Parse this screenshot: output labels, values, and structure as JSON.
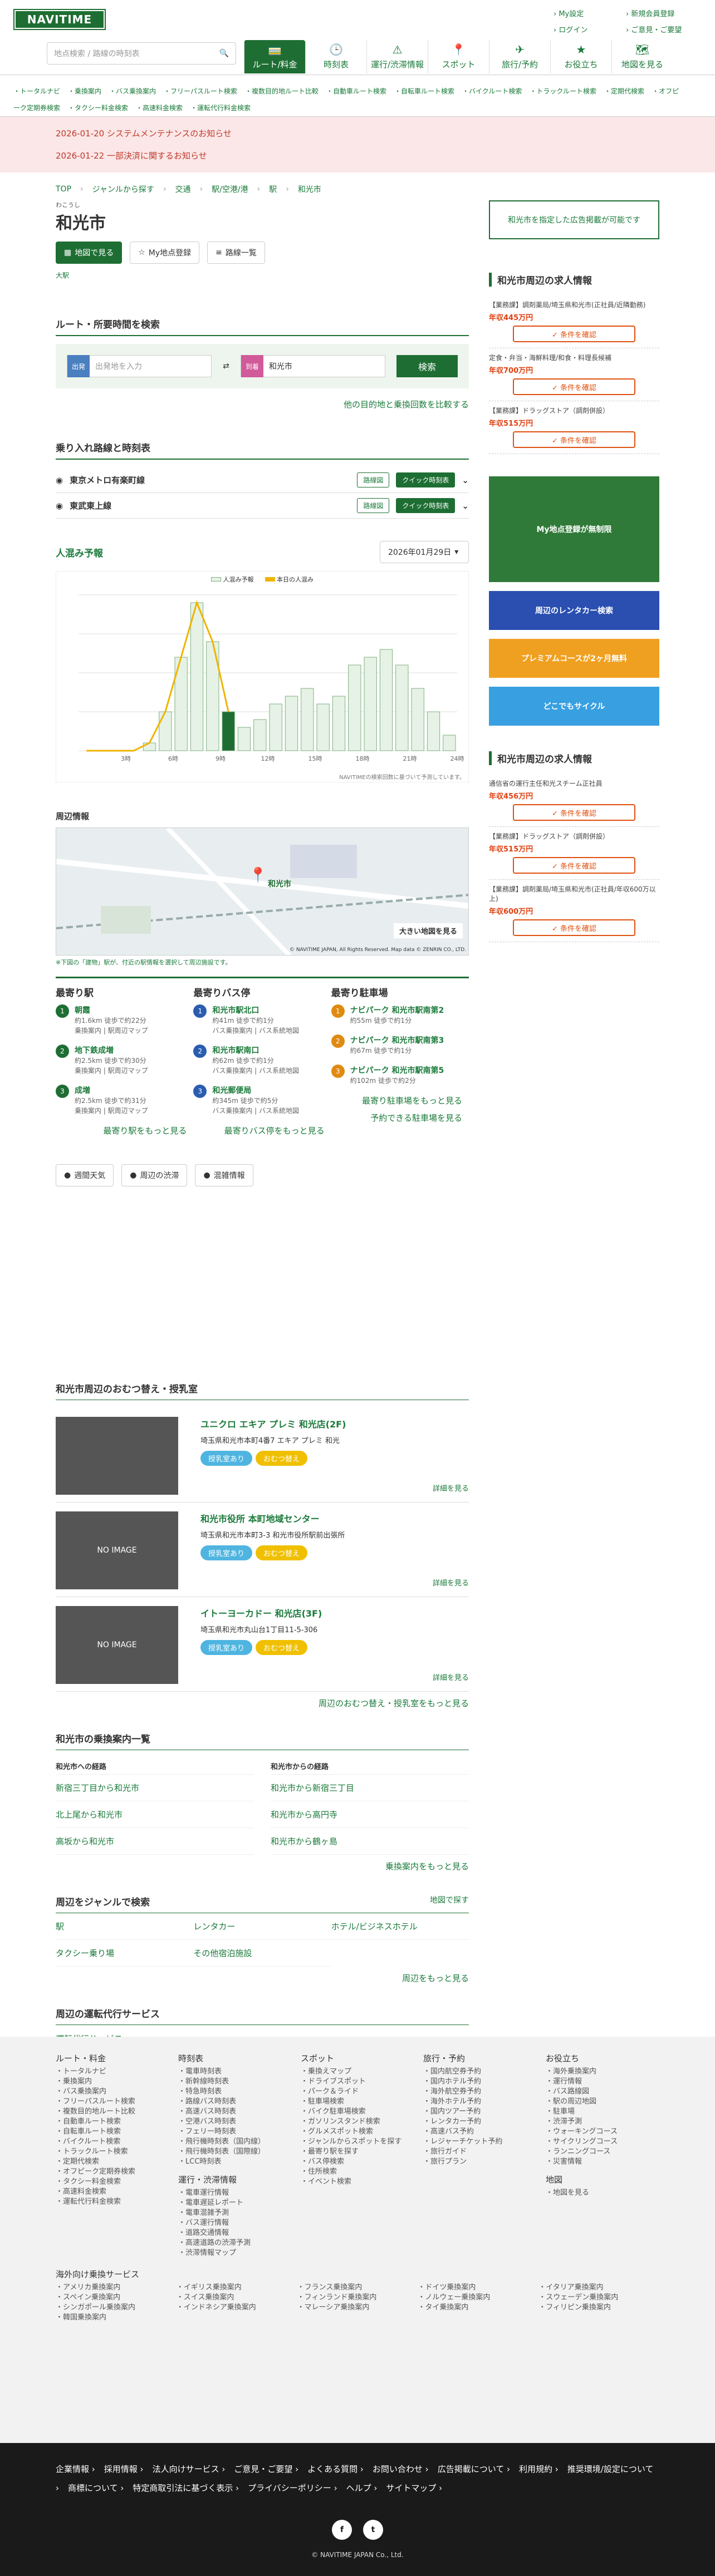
{
  "header": {
    "logo": "NAVITIME",
    "search_placeholder": "地点検索 / 路線の時刻表",
    "top_links": [
      "My設定",
      "新規会員登録",
      "ログイン",
      "ご意見・ご要望"
    ],
    "nav": [
      {
        "label": "ルート/料金",
        "icon": "🚃"
      },
      {
        "label": "時刻表",
        "icon": "🕒"
      },
      {
        "label": "運行/渋滞情報",
        "icon": "⚠"
      },
      {
        "label": "スポット",
        "icon": "📍"
      },
      {
        "label": "旅行/予約",
        "icon": "✈"
      },
      {
        "label": "お役立ち",
        "icon": "★"
      },
      {
        "label": "地図を見る",
        "icon": "🗺"
      }
    ],
    "subnav": [
      "トータルナビ",
      "乗換案内",
      "バス乗換案内",
      "フリーパスルート検索",
      "複数目的地ルート比較",
      "自動車ルート検索",
      "自転車ルート検索",
      "バイクルート検索",
      "トラックルート検索",
      "定期代検索",
      "オフピーク定期券検索",
      "タクシー料金検索",
      "高速料金検索",
      "運転代行料金検索"
    ]
  },
  "notices": [
    {
      "date": "2026-01-20",
      "text": "システムメンテナンスのお知らせ"
    },
    {
      "date": "2026-01-22",
      "text": "一部決済に関するお知らせ"
    }
  ],
  "breadcrumb": [
    "TOP",
    "ジャンルから探す",
    "交通",
    "駅/空港/港",
    "駅",
    "和光市"
  ],
  "station": {
    "ruby": "わこうし",
    "name": "和光市",
    "btn_map": "地図で見る",
    "btn_mypoint": "My地点登録",
    "btn_list": "路線一覧",
    "badge": "大駅"
  },
  "route": {
    "title": "ルート・所要時間を検索",
    "from_tag": "出発",
    "from_ph": "出発地を入力",
    "to_tag": "到着",
    "to_val": "和光市",
    "search": "検索",
    "compare": "他の目的地と乗換回数を比較する"
  },
  "lines": {
    "title": "乗り入れ路線と時刻表",
    "items": [
      {
        "name": "東京メトロ有楽町線",
        "btn1": "路線図",
        "btn2": "クイック時刻表"
      },
      {
        "name": "東武東上線",
        "btn1": "路線図",
        "btn2": "クイック時刻表"
      }
    ]
  },
  "crowd": {
    "title": "人混み予報",
    "date": "2026年01月29日",
    "legend1": "人混み予報",
    "legend2": "本日の人混み",
    "note": "NAVITIMEの検索回数に基づいて予測しています。"
  },
  "chart_data": {
    "type": "bar",
    "categories": [
      "0",
      "1",
      "2",
      "3",
      "4",
      "5",
      "6",
      "7",
      "8",
      "9",
      "10",
      "11",
      "12",
      "13",
      "14",
      "15",
      "16",
      "17",
      "18",
      "19",
      "20",
      "21",
      "22",
      "23"
    ],
    "series": [
      {
        "name": "人混み予報",
        "values": [
          0,
          0,
          0,
          0,
          5,
          25,
          60,
          95,
          70,
          25,
          15,
          20,
          30,
          35,
          40,
          30,
          35,
          55,
          60,
          65,
          55,
          40,
          25,
          10
        ]
      }
    ],
    "ylim": [
      0,
      100
    ],
    "xtick_labels": [
      "3時",
      "6時",
      "9時",
      "12時",
      "15時",
      "18時",
      "21時",
      "24時"
    ]
  },
  "map": {
    "title": "周辺情報",
    "caption": "※下図の「建物」駅が、付近の駅情報を選択して周辺施設です。",
    "copyright": "© NAVITIME JAPAN, All Rights Reserved. Map data © ZENRIN CO., LTD.",
    "big": "大きい地図を見る",
    "label_station": "和光市"
  },
  "nearby": {
    "stations": {
      "title": "最寄り駅",
      "items": [
        {
          "n": "1",
          "name": "朝霞",
          "d": "約1.6km 徒歩で約22分",
          "d2": "乗換案内 | 駅周辺マップ"
        },
        {
          "n": "2",
          "name": "地下鉄成増",
          "d": "約2.5km 徒歩で約30分",
          "d2": "乗換案内 | 駅周辺マップ"
        },
        {
          "n": "3",
          "name": "成増",
          "d": "約2.5km 徒歩で約31分",
          "d2": "乗換案内 | 駅周辺マップ"
        }
      ],
      "more": "最寄り駅をもっと見る"
    },
    "bus": {
      "title": "最寄りバス停",
      "items": [
        {
          "n": "1",
          "name": "和光市駅北口",
          "d": "約41m 徒歩で約1分",
          "d2": "バス乗換案内 | バス系統地図"
        },
        {
          "n": "2",
          "name": "和光市駅南口",
          "d": "約62m 徒歩で約1分",
          "d2": "バス乗換案内 | バス系統地図"
        },
        {
          "n": "3",
          "name": "和光郵便局",
          "d": "約345m 徒歩で約5分",
          "d2": "バス乗換案内 | バス系統地図"
        }
      ],
      "more": "最寄りバス停をもっと見る"
    },
    "parking": {
      "title": "最寄り駐車場",
      "items": [
        {
          "n": "1",
          "name": "ナビパーク 和光市駅南第2",
          "d": "約55m 徒歩で約1分"
        },
        {
          "n": "2",
          "name": "ナビパーク 和光市駅南第3",
          "d": "約67m 徒歩で約1分"
        },
        {
          "n": "3",
          "name": "ナビパーク 和光市駅南第5",
          "d": "約102m 徒歩で約2分"
        }
      ],
      "more": "最寄り駐車場をもっと見る",
      "more2": "予約できる駐車場を見る"
    }
  },
  "info_btns": [
    "週間天気",
    "周辺の渋滞",
    "混雑情報"
  ],
  "nursing": {
    "title": "和光市周辺のおむつ替え・授乳室",
    "items": [
      {
        "name": "ユニクロ エキア プレミ 和光店(2F)",
        "addr": "埼玉県和光市本町4番7 エキア プレミ 和光",
        "img": ""
      },
      {
        "name": "和光市役所 本町地域センター",
        "addr": "埼玉県和光市本町3-3 和光市役所駅前出張所",
        "img": "NO IMAGE"
      },
      {
        "name": "イトーヨーカドー 和光店(3F)",
        "addr": "埼玉県和光市丸山台1丁目11-5-306",
        "img": "NO IMAGE"
      }
    ],
    "pill1": "授乳室あり",
    "pill2": "おむつ替え",
    "detail": "詳細を見る",
    "more": "周辺のおむつ替え・授乳室をもっと見る"
  },
  "transfer": {
    "title": "和光市の乗換案内一覧",
    "to": "和光市への経路",
    "from": "和光市からの経路",
    "items_to": [
      "新宿三丁目から和光市",
      "北上尾から和光市",
      "高坂から和光市"
    ],
    "items_from": [
      "和光市から新宿三丁目",
      "和光市から高円寺",
      "和光市から鶴ヶ島"
    ],
    "more": "乗換案内をもっと見る"
  },
  "genre": {
    "title": "周辺をジャンルで検索",
    "map_link": "地図で探す",
    "items": [
      "駅",
      "レンタカー",
      "ホテル/ビジネスホテル",
      "タクシー乗り場",
      "その他宿泊施設"
    ],
    "more": "周辺をもっと見る"
  },
  "daiko": {
    "title": "周辺の運転代行サービス",
    "link": "運転代行サービス"
  },
  "side": {
    "ad_box": "和光市を指定した広告掲載が可能です",
    "jobs_title": "和光市周辺の求人情報",
    "jobs": [
      {
        "t": "【業務課】調剤薬局/埼玉県和光市(正社員/近隣勤務)",
        "pay": "年収445万円",
        "cta": "条件を確認"
      },
      {
        "t": "定食・弁当・海鮮料理/和食・料理長候補",
        "pay": "年収700万円",
        "cta": "条件を確認"
      },
      {
        "t": "【業務課】ドラッグストア（調剤併設）",
        "pay": "年収515万円",
        "cta": "条件を確認"
      }
    ],
    "banners": [
      "My地点登録が無制限",
      "周辺のレンタカー検索",
      "プレミアムコースが2ヶ月無料",
      "どこでもサイクル"
    ],
    "jobs2": [
      {
        "t": "通信省の運行主任和光スチーム正社員",
        "pay": "年収456万円",
        "cta": "条件を確認"
      },
      {
        "t": "【業務課】ドラッグストア（調剤併設）",
        "pay": "年収515万円",
        "cta": "条件を確認"
      },
      {
        "t": "【業務課】調剤薬局/埼玉県和光市(正社員/年収600万以上)",
        "pay": "年収600万円",
        "cta": "条件を確認"
      }
    ]
  },
  "footer": {
    "cols": [
      {
        "h": "ルート・料金",
        "items": [
          "トータルナビ",
          "乗換案内",
          "バス乗換案内",
          "フリーパスルート検索",
          "複数目的地ルート比較",
          "自動車ルート検索",
          "自転車ルート検索",
          "バイクルート検索",
          "トラックルート検索",
          "定期代検索",
          "オフピーク定期券検索",
          "タクシー料金検索",
          "高速料金検索",
          "運転代行料金検索"
        ]
      },
      {
        "h": "時刻表",
        "items": [
          "電車時刻表",
          "新幹線時刻表",
          "特急時刻表",
          "路線バス時刻表",
          "高速バス時刻表",
          "空港バス時刻表",
          "フェリー時刻表",
          "飛行機時刻表（国内線）",
          "飛行機時刻表（国際線）",
          "LCC時刻表"
        ]
      },
      {
        "h": "スポット",
        "items": [
          "乗換えマップ",
          "ドライブスポット",
          "パーク＆ライド",
          "駐車場検索",
          "バイク駐車場検索",
          "ガソリンスタンド検索",
          "グルメスポット検索",
          "ジャンルからスポットを探す",
          "最寄り駅を探す",
          "バス停検索",
          "住所検索",
          "イベント検索"
        ]
      },
      {
        "h": "旅行・予約",
        "items": [
          "国内航空券予約",
          "国内ホテル予約",
          "海外航空券予約",
          "海外ホテル予約",
          "国内ツアー予約",
          "レンタカー予約",
          "高速バス予約",
          "レジャーチケット予約",
          "旅行ガイド",
          "旅行プラン"
        ]
      },
      {
        "h": "お役立ち",
        "items": [
          "海外乗換案内",
          "運行情報",
          "バス路線図",
          "駅の周辺地図",
          "駐車場",
          "渋滞予測",
          "ウォーキングコース",
          "サイクリングコース",
          "ランニングコース",
          "災害情報"
        ]
      }
    ],
    "col2b": {
      "h": "運行・渋滞情報",
      "items": [
        "電車運行情報",
        "電車遅延レポート",
        "電車混雑予測",
        "バス運行情報",
        "道路交通情報",
        "高速道路の渋滞予測",
        "渋滞情報マップ"
      ]
    },
    "map": {
      "h": "地図",
      "items": [
        "地図を見る"
      ]
    },
    "overseas": {
      "h": "海外向け乗換サービス",
      "items": [
        "アメリカ乗換案内",
        "イギリス乗換案内",
        "フランス乗換案内",
        "ドイツ乗換案内",
        "イタリア乗換案内",
        "スペイン乗換案内",
        "スイス乗換案内",
        "フィンランド乗換案内",
        "ノルウェー乗換案内",
        "スウェーデン乗換案内",
        "シンガポール乗換案内",
        "インドネシア乗換案内",
        "マレーシア乗換案内",
        "タイ乗換案内",
        "フィリピン乗換案内",
        "韓国乗換案内"
      ]
    },
    "bottom": [
      "企業情報",
      "採用情報",
      "法人向けサービス",
      "ご意見・ご要望",
      "よくある質問",
      "お問い合わせ",
      "広告掲載について",
      "利用規約",
      "推奨環境/設定について",
      "商標について",
      "特定商取引法に基づく表示",
      "プライバシーポリシー",
      "ヘルプ",
      "サイトマップ"
    ],
    "copy": "© NAVITIME JAPAN Co., Ltd."
  },
  "colors": {
    "accent": "#1e6e33",
    "chart_fill": "#e5f2e5",
    "chart_today": "#f0b400"
  }
}
